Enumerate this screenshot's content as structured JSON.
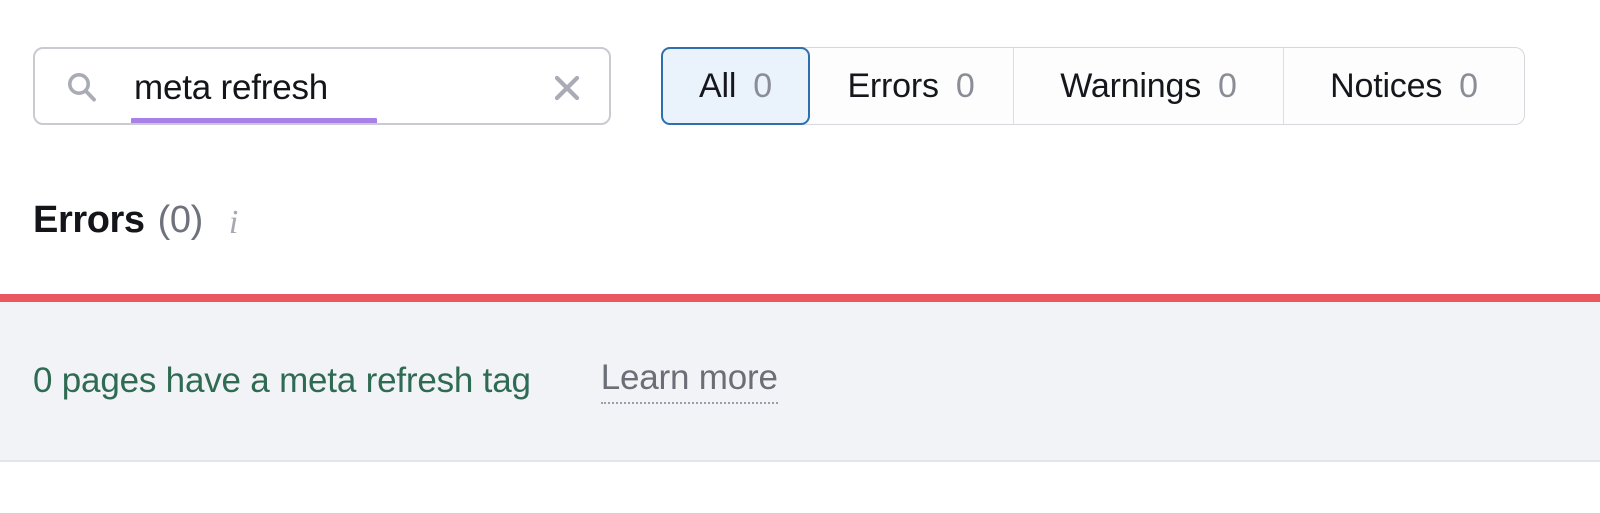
{
  "search": {
    "value": "meta refresh",
    "placeholder": "Search",
    "search_icon": "search-icon",
    "clear_icon": "close-icon",
    "underline_color": "#a97fe8"
  },
  "filter_tabs": [
    {
      "label": "All",
      "count": "0",
      "selected": true
    },
    {
      "label": "Errors",
      "count": "0",
      "selected": false
    },
    {
      "label": "Warnings",
      "count": "0",
      "selected": false
    },
    {
      "label": "Notices",
      "count": "0",
      "selected": false
    }
  ],
  "section": {
    "title": "Errors",
    "count": "(0)",
    "info_icon": "i"
  },
  "issues": [
    {
      "label": "0 pages have a meta refresh tag",
      "link_label": "Learn more",
      "severity_color": "#e8595f",
      "label_color": "#2e6b52"
    }
  ]
}
